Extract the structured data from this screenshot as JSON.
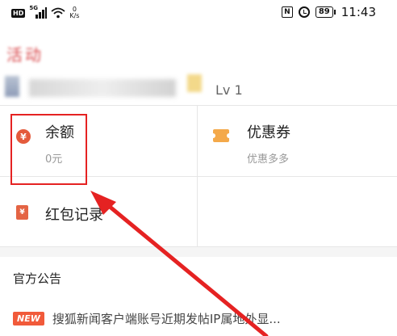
{
  "status_bar": {
    "hd": "HD",
    "signal": "5G",
    "speed_value": "0",
    "speed_unit": "K/s",
    "nfc": "N",
    "battery": "89",
    "time": "11:43"
  },
  "header": {
    "title": "活动",
    "level": "Lv 1"
  },
  "grid": {
    "balance": {
      "icon": "yen-icon",
      "title": "余额",
      "value": "0元"
    },
    "coupon": {
      "icon": "coupon-icon",
      "title": "优惠券",
      "subtitle": "优惠多多"
    },
    "red_packet": {
      "icon": "red-packet-icon",
      "title": "红包记录"
    }
  },
  "announcement": {
    "section_title": "官方公告",
    "badge": "NEW",
    "headline": "搜狐新闻客户端账号近期发帖IP属地外显..."
  },
  "colors": {
    "accent": "#e52222",
    "icon_red": "#e45b3c",
    "coupon": "#f4a94a",
    "badge": "#f15a3a"
  }
}
